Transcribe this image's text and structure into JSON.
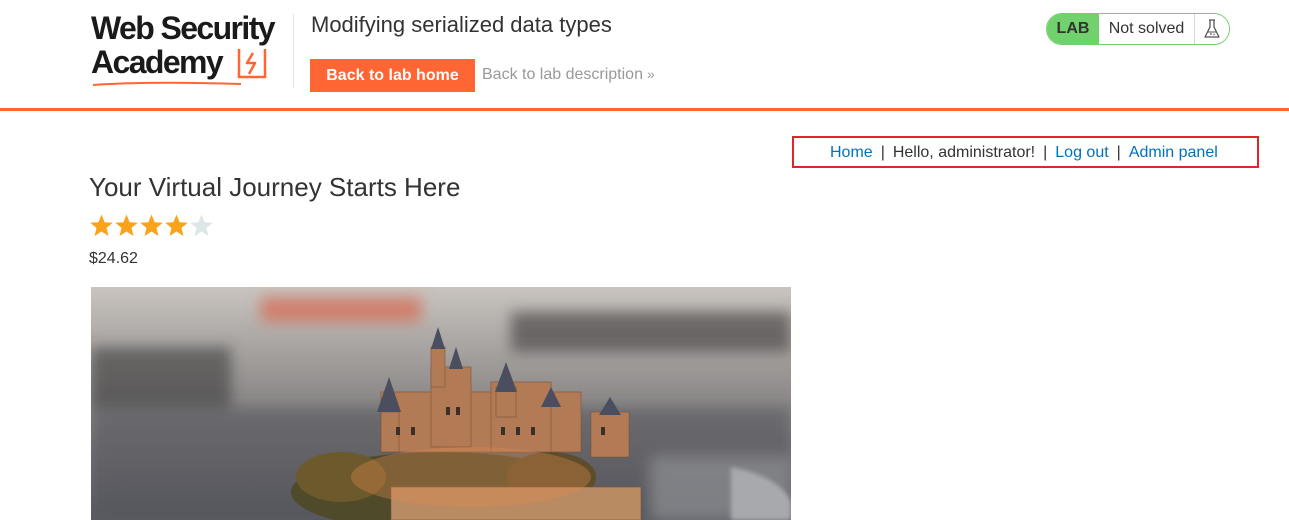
{
  "header": {
    "logo": {
      "line1": "Web Security",
      "line2": "Academy"
    },
    "lab_title": "Modifying serialized data types",
    "back_home_label": "Back to lab home",
    "back_description_label": "Back to lab description",
    "back_description_chevron": "»",
    "status": {
      "badge": "LAB",
      "text": "Not solved",
      "icon": "flask-icon"
    }
  },
  "nav": {
    "home": "Home",
    "greeting": "Hello, administrator!",
    "logout": "Log out",
    "admin": "Admin panel",
    "separator": "|"
  },
  "product": {
    "title": "Your Virtual Journey Starts Here",
    "rating": 4,
    "rating_max": 5,
    "price": "$24.62",
    "image_icon": "castle-on-phone-image"
  },
  "colors": {
    "accent": "#ff6633",
    "link": "#0071bc",
    "star_on": "#f9a21a",
    "star_off": "#dfe6ea",
    "lab_green": "#70d16d",
    "highlight_box": "#e3242b"
  }
}
